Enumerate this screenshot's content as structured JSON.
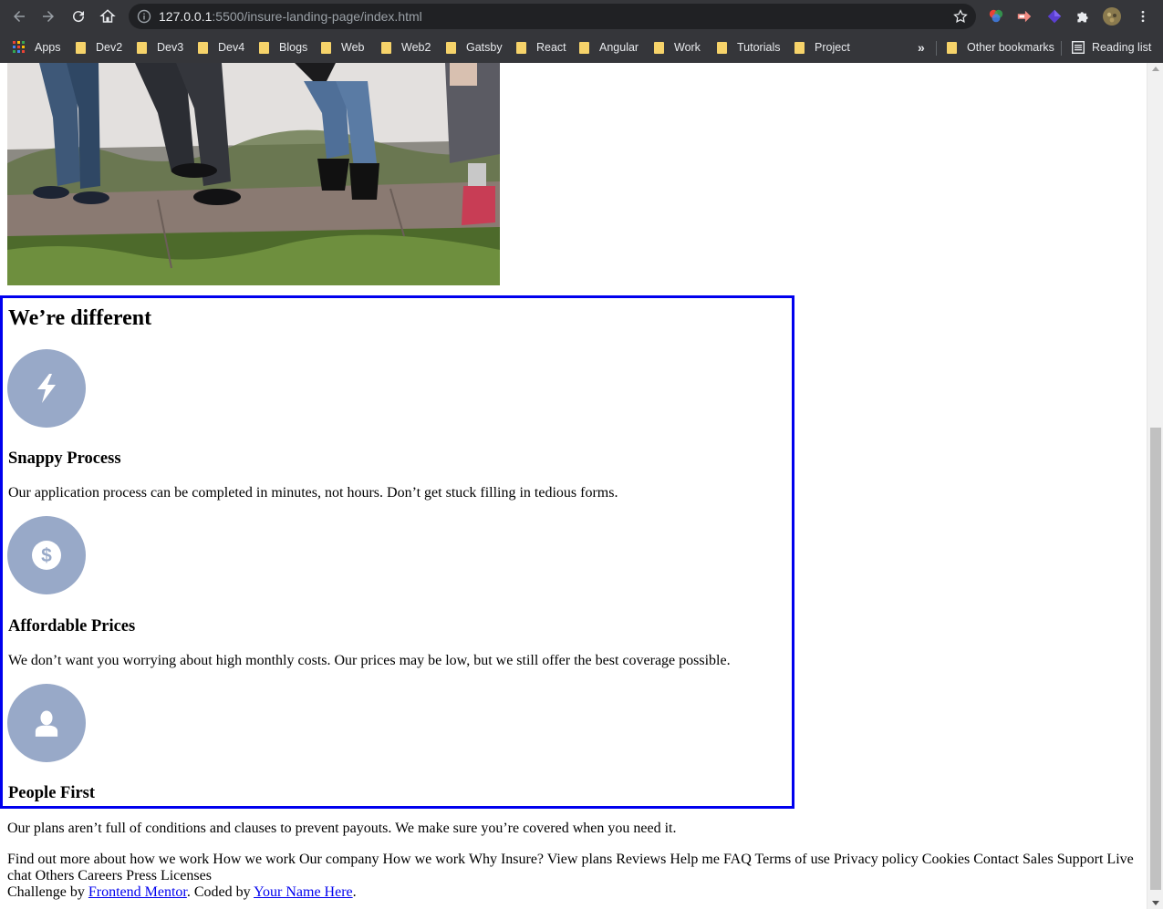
{
  "browser": {
    "url_host": "127.0.0.1",
    "url_path": ":5500/insure-landing-page/index.html",
    "bookmarks": [
      "Apps",
      "Dev2",
      "Dev3",
      "Dev4",
      "Blogs",
      "Web",
      "Web2",
      "Gatsby",
      "React",
      "Angular",
      "Work",
      "Tutorials",
      "Project"
    ],
    "overflow": "»",
    "other_bookmarks": "Other bookmarks",
    "reading_list": "Reading list"
  },
  "section": {
    "title": "We’re different",
    "features": [
      {
        "icon": "lightning-icon",
        "title": "Snappy Process",
        "text": "Our application process can be completed in minutes, not hours. Don’t get stuck filling in tedious forms."
      },
      {
        "icon": "dollar-icon",
        "title": "Affordable Prices",
        "text": "We don’t want you worrying about high monthly costs. Our prices may be low, but we still offer the best coverage possible."
      },
      {
        "icon": "person-icon",
        "title": "People First",
        "text": "Our plans aren’t full of conditions and clauses to prevent payouts. We make sure you’re covered when you need it."
      }
    ]
  },
  "footer": {
    "links_text": "Find out more about how we work How we work Our company How we work Why Insure? View plans Reviews Help me FAQ Terms of use Privacy policy Cookies Contact Sales Support Live chat Others Careers Press Licenses",
    "attribution_prefix": "Challenge by ",
    "attribution_link1": "Frontend Mentor",
    "attribution_mid": ". Coded by ",
    "attribution_link2": "Your Name Here",
    "attribution_suffix": "."
  },
  "colors": {
    "accent_border": "#0000ee",
    "icon_circle": "#98a9c8",
    "link": "#0000ee"
  }
}
